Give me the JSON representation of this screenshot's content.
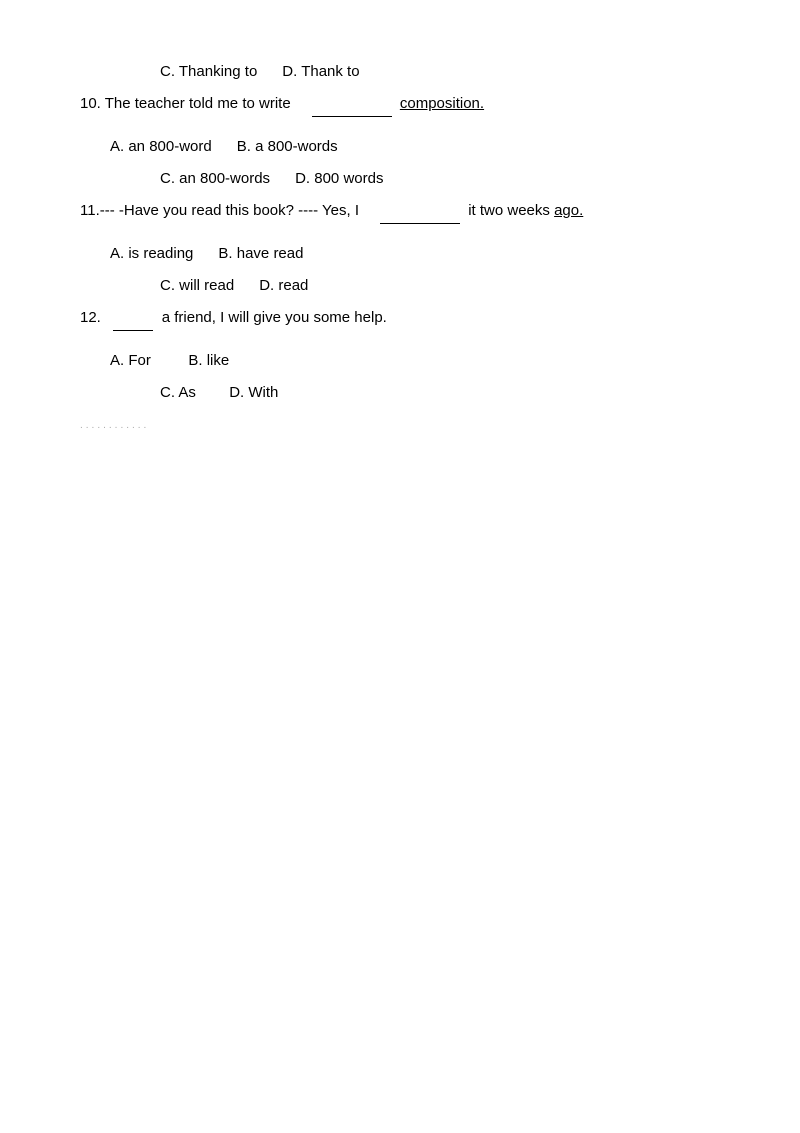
{
  "questions": {
    "q9_options": {
      "c": "C. Thanking to",
      "d": "D. Thank to"
    },
    "q10": {
      "stem": "10. The teacher told me to write",
      "blank_hint": "",
      "underlined": "composition.",
      "options": {
        "a": "A. an 800-word",
        "b": "B. a 800-words",
        "c": "C. an 800-words",
        "d": "D. 800 words"
      }
    },
    "q11": {
      "stem": "11.--- -Have you read this book?  ---- Yes, I",
      "suffix": "it two weeks",
      "underlined": "ago.",
      "options": {
        "a": "A. is reading",
        "b": "B. have read",
        "c": "C. will read",
        "d": "D. read"
      }
    },
    "q12": {
      "stem": "12.",
      "blank": "____",
      "suffix": "a friend, I will give you some help.",
      "options": {
        "a": "A. For",
        "b": "B. like",
        "c": "C. As",
        "d": "D. With"
      }
    }
  },
  "footer_dots": "............"
}
